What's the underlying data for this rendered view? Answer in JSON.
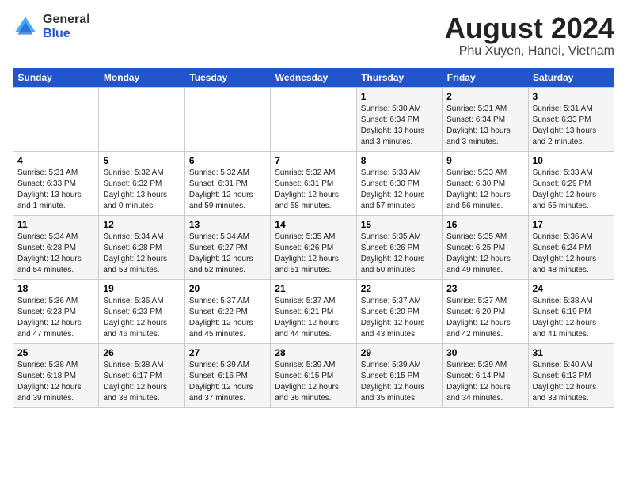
{
  "header": {
    "logo_line1": "General",
    "logo_line2": "Blue",
    "month_year": "August 2024",
    "location": "Phu Xuyen, Hanoi, Vietnam"
  },
  "weekdays": [
    "Sunday",
    "Monday",
    "Tuesday",
    "Wednesday",
    "Thursday",
    "Friday",
    "Saturday"
  ],
  "weeks": [
    [
      {
        "day": "",
        "info": ""
      },
      {
        "day": "",
        "info": ""
      },
      {
        "day": "",
        "info": ""
      },
      {
        "day": "",
        "info": ""
      },
      {
        "day": "1",
        "info": "Sunrise: 5:30 AM\nSunset: 6:34 PM\nDaylight: 13 hours\nand 3 minutes."
      },
      {
        "day": "2",
        "info": "Sunrise: 5:31 AM\nSunset: 6:34 PM\nDaylight: 13 hours\nand 3 minutes."
      },
      {
        "day": "3",
        "info": "Sunrise: 5:31 AM\nSunset: 6:33 PM\nDaylight: 13 hours\nand 2 minutes."
      }
    ],
    [
      {
        "day": "4",
        "info": "Sunrise: 5:31 AM\nSunset: 6:33 PM\nDaylight: 13 hours\nand 1 minute."
      },
      {
        "day": "5",
        "info": "Sunrise: 5:32 AM\nSunset: 6:32 PM\nDaylight: 13 hours\nand 0 minutes."
      },
      {
        "day": "6",
        "info": "Sunrise: 5:32 AM\nSunset: 6:31 PM\nDaylight: 12 hours\nand 59 minutes."
      },
      {
        "day": "7",
        "info": "Sunrise: 5:32 AM\nSunset: 6:31 PM\nDaylight: 12 hours\nand 58 minutes."
      },
      {
        "day": "8",
        "info": "Sunrise: 5:33 AM\nSunset: 6:30 PM\nDaylight: 12 hours\nand 57 minutes."
      },
      {
        "day": "9",
        "info": "Sunrise: 5:33 AM\nSunset: 6:30 PM\nDaylight: 12 hours\nand 56 minutes."
      },
      {
        "day": "10",
        "info": "Sunrise: 5:33 AM\nSunset: 6:29 PM\nDaylight: 12 hours\nand 55 minutes."
      }
    ],
    [
      {
        "day": "11",
        "info": "Sunrise: 5:34 AM\nSunset: 6:28 PM\nDaylight: 12 hours\nand 54 minutes."
      },
      {
        "day": "12",
        "info": "Sunrise: 5:34 AM\nSunset: 6:28 PM\nDaylight: 12 hours\nand 53 minutes."
      },
      {
        "day": "13",
        "info": "Sunrise: 5:34 AM\nSunset: 6:27 PM\nDaylight: 12 hours\nand 52 minutes."
      },
      {
        "day": "14",
        "info": "Sunrise: 5:35 AM\nSunset: 6:26 PM\nDaylight: 12 hours\nand 51 minutes."
      },
      {
        "day": "15",
        "info": "Sunrise: 5:35 AM\nSunset: 6:26 PM\nDaylight: 12 hours\nand 50 minutes."
      },
      {
        "day": "16",
        "info": "Sunrise: 5:35 AM\nSunset: 6:25 PM\nDaylight: 12 hours\nand 49 minutes."
      },
      {
        "day": "17",
        "info": "Sunrise: 5:36 AM\nSunset: 6:24 PM\nDaylight: 12 hours\nand 48 minutes."
      }
    ],
    [
      {
        "day": "18",
        "info": "Sunrise: 5:36 AM\nSunset: 6:23 PM\nDaylight: 12 hours\nand 47 minutes."
      },
      {
        "day": "19",
        "info": "Sunrise: 5:36 AM\nSunset: 6:23 PM\nDaylight: 12 hours\nand 46 minutes."
      },
      {
        "day": "20",
        "info": "Sunrise: 5:37 AM\nSunset: 6:22 PM\nDaylight: 12 hours\nand 45 minutes."
      },
      {
        "day": "21",
        "info": "Sunrise: 5:37 AM\nSunset: 6:21 PM\nDaylight: 12 hours\nand 44 minutes."
      },
      {
        "day": "22",
        "info": "Sunrise: 5:37 AM\nSunset: 6:20 PM\nDaylight: 12 hours\nand 43 minutes."
      },
      {
        "day": "23",
        "info": "Sunrise: 5:37 AM\nSunset: 6:20 PM\nDaylight: 12 hours\nand 42 minutes."
      },
      {
        "day": "24",
        "info": "Sunrise: 5:38 AM\nSunset: 6:19 PM\nDaylight: 12 hours\nand 41 minutes."
      }
    ],
    [
      {
        "day": "25",
        "info": "Sunrise: 5:38 AM\nSunset: 6:18 PM\nDaylight: 12 hours\nand 39 minutes."
      },
      {
        "day": "26",
        "info": "Sunrise: 5:38 AM\nSunset: 6:17 PM\nDaylight: 12 hours\nand 38 minutes."
      },
      {
        "day": "27",
        "info": "Sunrise: 5:39 AM\nSunset: 6:16 PM\nDaylight: 12 hours\nand 37 minutes."
      },
      {
        "day": "28",
        "info": "Sunrise: 5:39 AM\nSunset: 6:15 PM\nDaylight: 12 hours\nand 36 minutes."
      },
      {
        "day": "29",
        "info": "Sunrise: 5:39 AM\nSunset: 6:15 PM\nDaylight: 12 hours\nand 35 minutes."
      },
      {
        "day": "30",
        "info": "Sunrise: 5:39 AM\nSunset: 6:14 PM\nDaylight: 12 hours\nand 34 minutes."
      },
      {
        "day": "31",
        "info": "Sunrise: 5:40 AM\nSunset: 6:13 PM\nDaylight: 12 hours\nand 33 minutes."
      }
    ]
  ]
}
